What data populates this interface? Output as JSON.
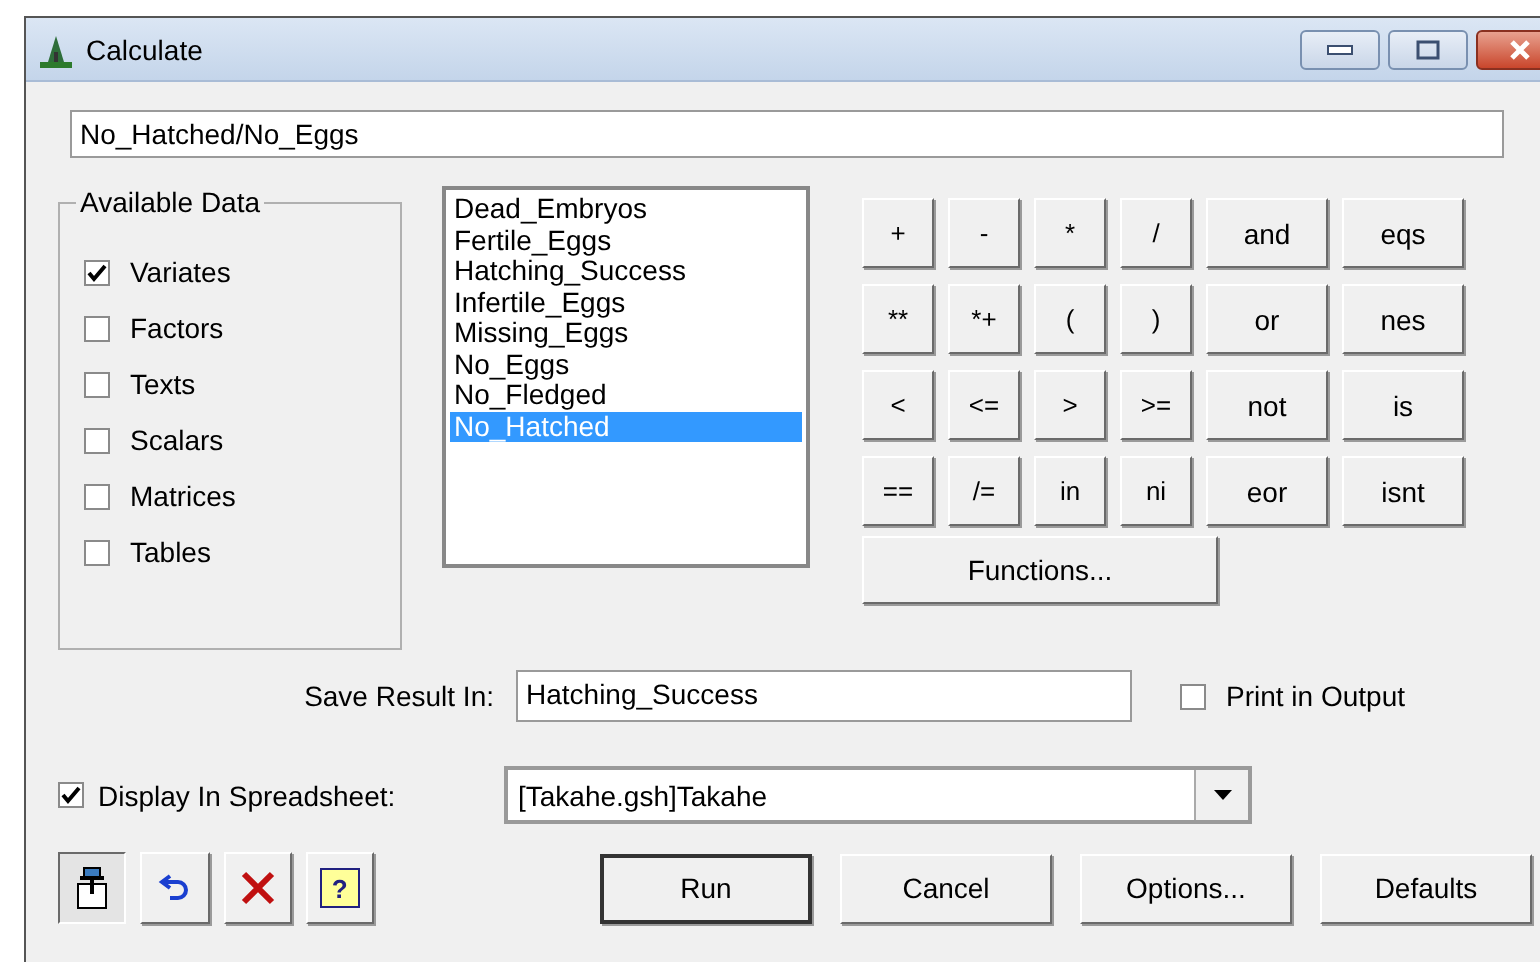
{
  "window": {
    "title": "Calculate"
  },
  "expression": {
    "value": "No_Hatched/No_Eggs"
  },
  "available_data": {
    "title": "Available Data",
    "items": [
      {
        "label": "Variates",
        "checked": true
      },
      {
        "label": "Factors",
        "checked": false
      },
      {
        "label": "Texts",
        "checked": false
      },
      {
        "label": "Scalars",
        "checked": false
      },
      {
        "label": "Matrices",
        "checked": false
      },
      {
        "label": "Tables",
        "checked": false
      }
    ]
  },
  "data_list": {
    "items": [
      {
        "label": "Dead_Embryos",
        "selected": false
      },
      {
        "label": "Fertile_Eggs",
        "selected": false
      },
      {
        "label": "Hatching_Success",
        "selected": false
      },
      {
        "label": "Infertile_Eggs",
        "selected": false
      },
      {
        "label": "Missing_Eggs",
        "selected": false
      },
      {
        "label": "No_Eggs",
        "selected": false
      },
      {
        "label": "No_Fledged",
        "selected": false
      },
      {
        "label": "No_Hatched",
        "selected": true
      }
    ]
  },
  "operators": [
    {
      "label": "+",
      "kind": "symbol"
    },
    {
      "label": "-",
      "kind": "symbol"
    },
    {
      "label": "*",
      "kind": "symbol"
    },
    {
      "label": "/",
      "kind": "symbol"
    },
    {
      "label": "and",
      "kind": "word"
    },
    {
      "label": "eqs",
      "kind": "word"
    },
    {
      "label": "**",
      "kind": "symbol"
    },
    {
      "label": "*+",
      "kind": "symbol"
    },
    {
      "label": "(",
      "kind": "symbol"
    },
    {
      "label": ")",
      "kind": "symbol"
    },
    {
      "label": "or",
      "kind": "word"
    },
    {
      "label": "nes",
      "kind": "word"
    },
    {
      "label": "<",
      "kind": "symbol"
    },
    {
      "label": "<=",
      "kind": "symbol"
    },
    {
      "label": ">",
      "kind": "symbol"
    },
    {
      "label": ">=",
      "kind": "symbol"
    },
    {
      "label": "not",
      "kind": "word"
    },
    {
      "label": "is",
      "kind": "word"
    },
    {
      "label": "==",
      "kind": "symbol"
    },
    {
      "label": "/=",
      "kind": "symbol"
    },
    {
      "label": "in",
      "kind": "symbol"
    },
    {
      "label": "ni",
      "kind": "symbol"
    },
    {
      "label": "eor",
      "kind": "word"
    },
    {
      "label": "isnt",
      "kind": "word"
    }
  ],
  "functions_button": "Functions...",
  "save_result": {
    "label": "Save Result In:",
    "value": "Hatching_Success"
  },
  "print_in_output": {
    "label": "Print in Output",
    "checked": false
  },
  "display_in_spreadsheet": {
    "label": "Display In Spreadsheet:",
    "checked": true,
    "value": "[Takahe.gsh]Takahe"
  },
  "toolbar": [
    {
      "kind": "pin",
      "pressed": true
    },
    {
      "kind": "undo",
      "pressed": false
    },
    {
      "kind": "delete",
      "pressed": false
    },
    {
      "kind": "help",
      "glyph": "?",
      "pressed": false
    }
  ],
  "buttons": [
    {
      "label": "Run",
      "default": true
    },
    {
      "label": "Cancel",
      "default": false
    },
    {
      "label": "Options...",
      "default": false
    },
    {
      "label": "Defaults",
      "default": false
    }
  ]
}
